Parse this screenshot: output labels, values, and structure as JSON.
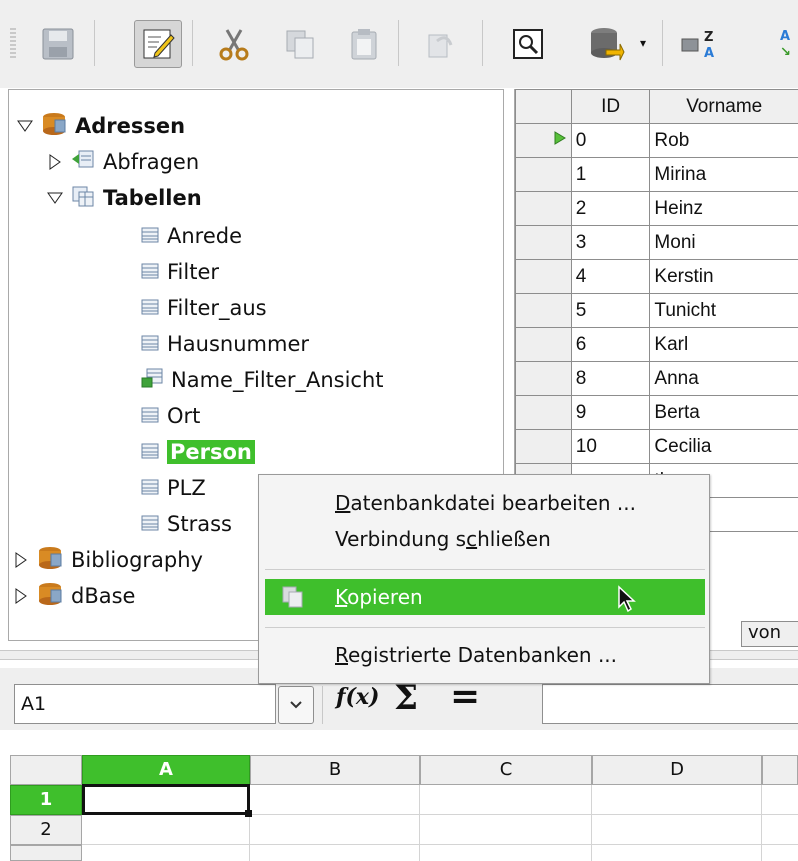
{
  "toolbar": {
    "icons": [
      "save-icon",
      "edit-icon",
      "cut-icon",
      "copy-icon",
      "paste-icon",
      "undo-icon",
      "preview-icon",
      "database-icon",
      "dropdown-arrow-icon",
      "sort-icon",
      "sort2-icon"
    ]
  },
  "tree": {
    "root": "Adressen",
    "queries": "Abfragen",
    "tables": "Tabellen",
    "items": [
      "Anrede",
      "Filter",
      "Filter_aus",
      "Hausnummer",
      "Name_Filter_Ansicht",
      "Ort",
      "Person",
      "PLZ",
      "Strass"
    ],
    "others": [
      "Bibliography",
      "dBase"
    ]
  },
  "table": {
    "col_id": "ID",
    "col_vorname": "Vorname",
    "rows": [
      {
        "id": "0",
        "name": "Rob"
      },
      {
        "id": "1",
        "name": "Mirina"
      },
      {
        "id": "2",
        "name": "Heinz"
      },
      {
        "id": "3",
        "name": "Moni"
      },
      {
        "id": "4",
        "name": "Kerstin"
      },
      {
        "id": "5",
        "name": "Tunicht"
      },
      {
        "id": "6",
        "name": "Karl"
      },
      {
        "id": "8",
        "name": "Anna"
      },
      {
        "id": "9",
        "name": "Berta"
      },
      {
        "id": "10",
        "name": "Cecilia"
      }
    ],
    "partial_1": "thea",
    "partial_2": "de",
    "nav_text": "von"
  },
  "menu": {
    "edit_file_pre": "",
    "edit_file_ul": "D",
    "edit_file_post": "atenbankdatei bearbeiten ...",
    "close_pre": "Verbindung s",
    "close_ul": "c",
    "close_post": "hließen",
    "copy_pre": "",
    "copy_ul": "K",
    "copy_post": "opieren",
    "registered_pre": "",
    "registered_ul": "R",
    "registered_post": "egistrierte Datenbanken ..."
  },
  "formula": {
    "cell_ref": "A1",
    "fx": "f(x)",
    "sum": "Σ",
    "equals": "="
  },
  "sheet": {
    "columns": [
      "A",
      "B",
      "C",
      "D"
    ],
    "rows": [
      "1",
      "2"
    ]
  },
  "colors": {
    "accent": "#3fbf2c",
    "toolbar_bg": "#efefef"
  }
}
